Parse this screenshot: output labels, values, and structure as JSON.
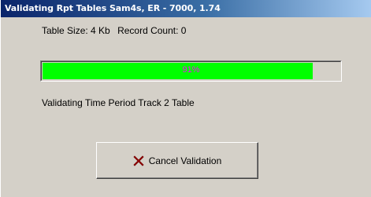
{
  "window": {
    "title": "Validating Rpt Tables Sam4s, ER - 7000, 1.74"
  },
  "info": {
    "table_size": "Table Size: 4 Kb",
    "record_count": "Record Count: 0"
  },
  "progress": {
    "percent": 91,
    "label": "91%",
    "fill_color": "#00ff00",
    "label_color": "#ff00ff"
  },
  "status": {
    "text": "Validating Time Period Track 2 Table"
  },
  "cancel_button": {
    "label": "Cancel Validation",
    "icon": "close-x-icon",
    "icon_color": "#b00000"
  }
}
